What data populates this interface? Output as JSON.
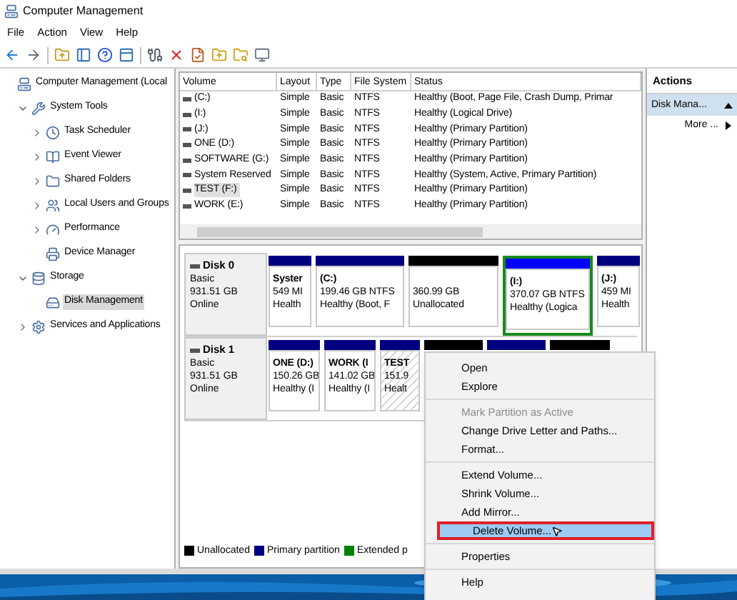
{
  "window": {
    "title": "Computer Management"
  },
  "menu": [
    "File",
    "Action",
    "View",
    "Help"
  ],
  "tree": [
    {
      "label": "Computer Management (Local",
      "selected": false,
      "children": [
        {
          "label": "System Tools",
          "selected": false,
          "expanded": true,
          "children": [
            {
              "label": "Task Scheduler",
              "selected": false,
              "expanded": false
            },
            {
              "label": "Event Viewer",
              "selected": false,
              "expanded": false
            },
            {
              "label": "Shared Folders",
              "selected": false,
              "expanded": false
            },
            {
              "label": "Local Users and Groups",
              "selected": false,
              "expanded": false
            },
            {
              "label": "Performance",
              "selected": false,
              "expanded": false
            },
            {
              "label": "Device Manager",
              "selected": false
            }
          ]
        },
        {
          "label": "Storage",
          "selected": false,
          "expanded": true,
          "children": [
            {
              "label": "Disk Management",
              "selected": true
            }
          ]
        },
        {
          "label": "Services and Applications",
          "selected": false,
          "expanded": false
        }
      ]
    }
  ],
  "volumes": {
    "columns": [
      "Volume",
      "Layout",
      "Type",
      "File System",
      "Status"
    ],
    "rows": [
      {
        "cells": [
          "(C:)",
          "Simple",
          "Basic",
          "NTFS",
          "Healthy (Boot, Page File, Crash Dump, Primar"
        ],
        "selected": false
      },
      {
        "cells": [
          "(I:)",
          "Simple",
          "Basic",
          "NTFS",
          "Healthy (Logical Drive)"
        ],
        "selected": false
      },
      {
        "cells": [
          "(J:)",
          "Simple",
          "Basic",
          "NTFS",
          "Healthy (Primary Partition)"
        ],
        "selected": false
      },
      {
        "cells": [
          "ONE (D:)",
          "Simple",
          "Basic",
          "NTFS",
          "Healthy (Primary Partition)"
        ],
        "selected": false
      },
      {
        "cells": [
          "SOFTWARE (G:)",
          "Simple",
          "Basic",
          "NTFS",
          "Healthy (Primary Partition)"
        ],
        "selected": false
      },
      {
        "cells": [
          "System Reserved",
          "Simple",
          "Basic",
          "NTFS",
          "Healthy (System, Active, Primary Partition)"
        ],
        "selected": false
      },
      {
        "cells": [
          "TEST (F:)",
          "Simple",
          "Basic",
          "NTFS",
          "Healthy (Primary Partition)"
        ],
        "selected": true
      },
      {
        "cells": [
          "WORK (E:)",
          "Simple",
          "Basic",
          "NTFS",
          "Healthy (Primary Partition)"
        ],
        "selected": false
      }
    ]
  },
  "disks": [
    {
      "name": "Disk 0",
      "lines": [
        "Basic",
        "931.51 GB",
        "Online"
      ],
      "partitions": [
        {
          "kind": "primary",
          "selected": false,
          "lines": [
            "Syster",
            "549 MI",
            "Health"
          ]
        },
        {
          "kind": "primary",
          "selected": false,
          "lines": [
            "(C:)",
            "199.46 GB NTFS",
            "Healthy (Boot, F"
          ]
        },
        {
          "kind": "unallocated",
          "selected": false,
          "lines": [
            "360.99 GB",
            "Unallocated"
          ]
        },
        {
          "kind": "logical",
          "selected": false,
          "lines": [
            "(I:)",
            "370.07 GB NTFS",
            "Healthy (Logica"
          ]
        },
        {
          "kind": "primary",
          "selected": false,
          "lines": [
            "(J:)",
            "459 MI",
            "Health"
          ]
        }
      ]
    },
    {
      "name": "Disk 1",
      "lines": [
        "Basic",
        "931.51 GB",
        "Online"
      ],
      "partitions": [
        {
          "kind": "primary",
          "selected": false,
          "lines": [
            "ONE  (D:)",
            "150.26 GB",
            "Healthy (I"
          ]
        },
        {
          "kind": "primary",
          "selected": false,
          "lines": [
            "WORK  (I",
            "141.02 GB",
            "Healthy (I"
          ]
        },
        {
          "kind": "primary",
          "selected": true,
          "lines": [
            "TEST",
            "151.9",
            "Healt"
          ]
        },
        {
          "kind": "unallocated"
        },
        {
          "kind": "primary"
        },
        {
          "kind": "unallocated"
        }
      ]
    }
  ],
  "legend": [
    {
      "label": "Unallocated",
      "color": "#000000"
    },
    {
      "label": "Primary partition",
      "color": "#000080"
    },
    {
      "label": "Extended p",
      "color": "#008000"
    }
  ],
  "actions": {
    "header": "Actions",
    "items": [
      {
        "label": "Disk Mana...",
        "kind": "section",
        "expanded": true
      },
      {
        "label": "More ...",
        "kind": "more"
      }
    ]
  },
  "context_menu": {
    "groups": [
      [
        {
          "label": "Open",
          "disabled": false,
          "selected": false
        },
        {
          "label": "Explore",
          "disabled": false,
          "selected": false
        }
      ],
      [
        {
          "label": "Mark Partition as Active",
          "disabled": true,
          "selected": false
        },
        {
          "label": "Change Drive Letter and Paths...",
          "disabled": false,
          "selected": false
        },
        {
          "label": "Format...",
          "disabled": false,
          "selected": false
        }
      ],
      [
        {
          "label": "Extend Volume...",
          "disabled": false,
          "selected": false
        },
        {
          "label": "Shrink Volume...",
          "disabled": false,
          "selected": false
        },
        {
          "label": "Add Mirror...",
          "disabled": false,
          "selected": false
        },
        {
          "label": "Delete Volume...",
          "disabled": false,
          "selected": true
        }
      ],
      [
        {
          "label": "Properties",
          "disabled": false,
          "selected": false
        }
      ],
      [
        {
          "label": "Help",
          "disabled": false,
          "selected": false
        }
      ]
    ]
  }
}
